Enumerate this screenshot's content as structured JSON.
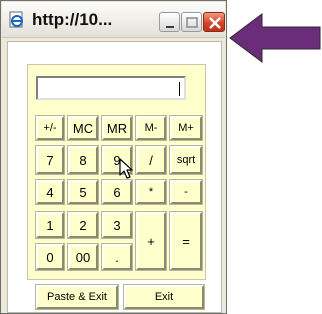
{
  "window": {
    "title": "http://10...",
    "colors": {
      "close_button": "#d6442a",
      "calc_panel": "#ffffcc"
    }
  },
  "icons": {
    "app": "ie-page-icon",
    "minimize": "minimize-icon",
    "maximize": "maximize-icon",
    "close": "close-icon",
    "pointer": "mouse-pointer-icon",
    "annotation": "arrow-icon"
  },
  "display": {
    "value": ""
  },
  "keys": {
    "plus_minus": "+/-",
    "mc": "MC",
    "mr": "MR",
    "m_minus": "M-",
    "m_plus": "M+",
    "seven": "7",
    "eight": "8",
    "nine": "9",
    "divide": "/",
    "sqrt": "sqrt",
    "four": "4",
    "five": "5",
    "six": "6",
    "multiply": "*",
    "subtract": "-",
    "one": "1",
    "two": "2",
    "three": "3",
    "add": "+",
    "equals": "=",
    "zero": "0",
    "double_zero": "00",
    "decimal": "."
  },
  "actions": {
    "paste_exit": "Paste & Exit",
    "exit": "Exit"
  },
  "annotation": {
    "arrow_color": "#6b2d7a"
  }
}
